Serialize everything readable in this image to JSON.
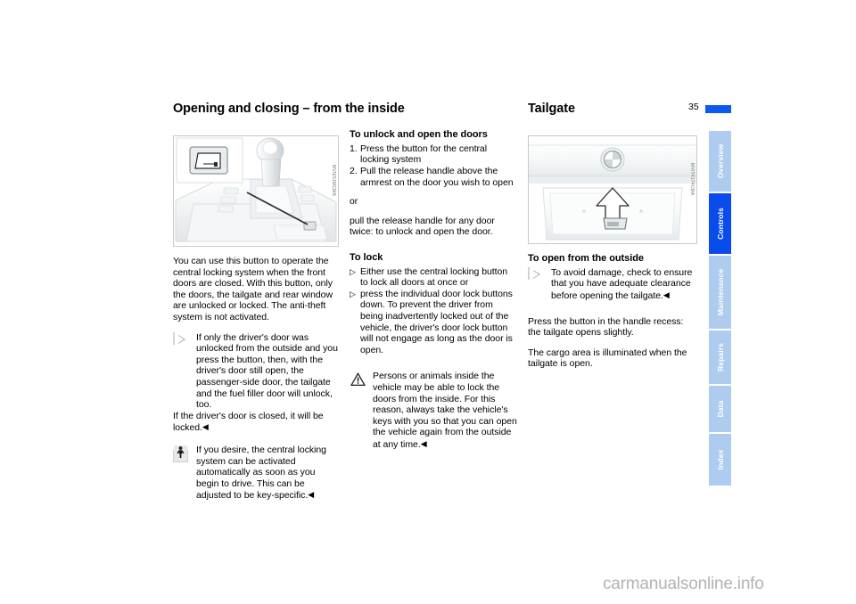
{
  "page": {
    "number": "35",
    "watermark": "carmanualsonline.info"
  },
  "left_column": {
    "title": "Opening and closing – from the inside",
    "figure": {
      "name": "center-console-central-locking-button",
      "code": "MVIE51MCMA"
    },
    "intro": "You can use this button to operate the central locking system when the front doors are closed. With this button, only the doors, the tailgate and rear window are unlocked or locked. The anti-theft system is not activated.",
    "note_1": {
      "icon": "note-icon",
      "text": "If only the driver's door was unlocked from the outside and you press the button, then, with the driver's door still open, the passenger-side door, the tailgate and the fuel filler door will unlock, too.",
      "text_2": "If the driver's door is closed, it will be locked.",
      "end_mark": "◀"
    },
    "note_2": {
      "icon": "pedestrian-icon",
      "text": "If you desire, the central locking system can be activated automatically as soon as you begin to drive. This can be adjusted to be key-specific.",
      "end_mark": "◀"
    }
  },
  "middle_column": {
    "section_1": {
      "heading": "To unlock and open the doors",
      "steps": [
        {
          "mark": "1.",
          "text": "Press the button for the central locking system"
        },
        {
          "mark": "2.",
          "text": "Pull the release handle above the armrest on the door you wish to open"
        }
      ],
      "or_text": "or",
      "after_text": "pull the release handle for any door twice: to unlock and open the door."
    },
    "section_2": {
      "heading": "To lock",
      "bullets": [
        {
          "mark": "▷",
          "text": "Either use the central locking button to lock all doors at once or"
        },
        {
          "mark": "▷",
          "text": "press the individual door lock buttons down. To prevent the driver from being inadvertently locked out of the vehicle, the driver's door lock button will not engage as long as the door is open."
        }
      ]
    },
    "warning": {
      "icon": "warning-triangle-icon",
      "text": "Persons or animals inside the vehicle may be able to lock the doors from the inside. For this reason, always take the vehicle's keys with you so that you can open the vehicle again from the outside at any time.",
      "end_mark": "◀"
    }
  },
  "right_column": {
    "title": "Tailgate",
    "figure": {
      "name": "tailgate-handle-recess",
      "code": "MVIT4174CMA"
    },
    "heading": "To open from the outside",
    "note": {
      "icon": "note-icon",
      "text": "To avoid damage, check to ensure that you have adequate clearance before opening the tailgate.",
      "end_mark": "◀"
    },
    "paragraph_1": "Press the button in the handle recess: the tailgate opens slightly.",
    "paragraph_2": "The cargo area is illuminated when the tailgate is open."
  },
  "tab_rail": {
    "active_index": 1,
    "tabs": [
      {
        "label": "Overview",
        "height": 68
      },
      {
        "label": "Controls",
        "height": 68
      },
      {
        "label": "Maintenance",
        "height": 82
      },
      {
        "label": "Repairs",
        "height": 60
      },
      {
        "label": "Data",
        "height": 52
      },
      {
        "label": "Index",
        "height": 58
      }
    ]
  },
  "colors": {
    "accent_blue": "#0a4ceb",
    "tab_blue": "#aecbf0",
    "rule_blue": "#0a5bf0"
  }
}
